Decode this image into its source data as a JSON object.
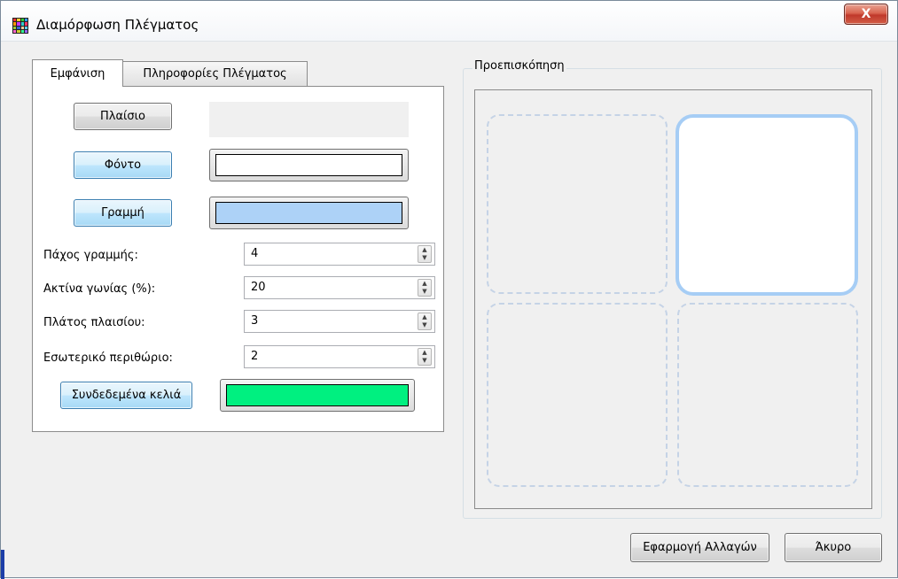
{
  "window": {
    "title": "Διαμόρφωση Πλέγματος",
    "close_label": "X",
    "icon_colors": [
      "#e33",
      "#fc3",
      "#3c3",
      "#39f",
      "#f90",
      "#c3f",
      "#3cc",
      "#f36",
      "#9c3",
      "#36c",
      "#fc9",
      "#6cf",
      "#f6c",
      "#cc3",
      "#3f9",
      "#96f"
    ]
  },
  "tabs": [
    {
      "label": "Εμφάνιση",
      "active": true
    },
    {
      "label": "Πληροφορίες Πλέγματος",
      "active": false
    }
  ],
  "appearance": {
    "frame_button": "Πλαίσιο",
    "background_button": "Φόντο",
    "line_button": "Γραμμή",
    "background_color": "#ffffff",
    "line_color": "#add2f7",
    "fields": [
      {
        "label": "Πάχος γραμμής:",
        "value": "4"
      },
      {
        "label": "Ακτίνα γωνίας (%):",
        "value": "20"
      },
      {
        "label": "Πλάτος πλαισίου:",
        "value": "3"
      },
      {
        "label": "Εσωτερικό περιθώριο:",
        "value": "2"
      }
    ],
    "linked_cells_button": "Συνδεδεμένα κελιά",
    "linked_cells_color": "#00f080"
  },
  "preview": {
    "label": "Προεπισκόπηση",
    "selected_border_color": "#a6cdf5"
  },
  "footer": {
    "apply_label": "Εφαρμογή Αλλαγών",
    "cancel_label": "Άκυρο"
  }
}
